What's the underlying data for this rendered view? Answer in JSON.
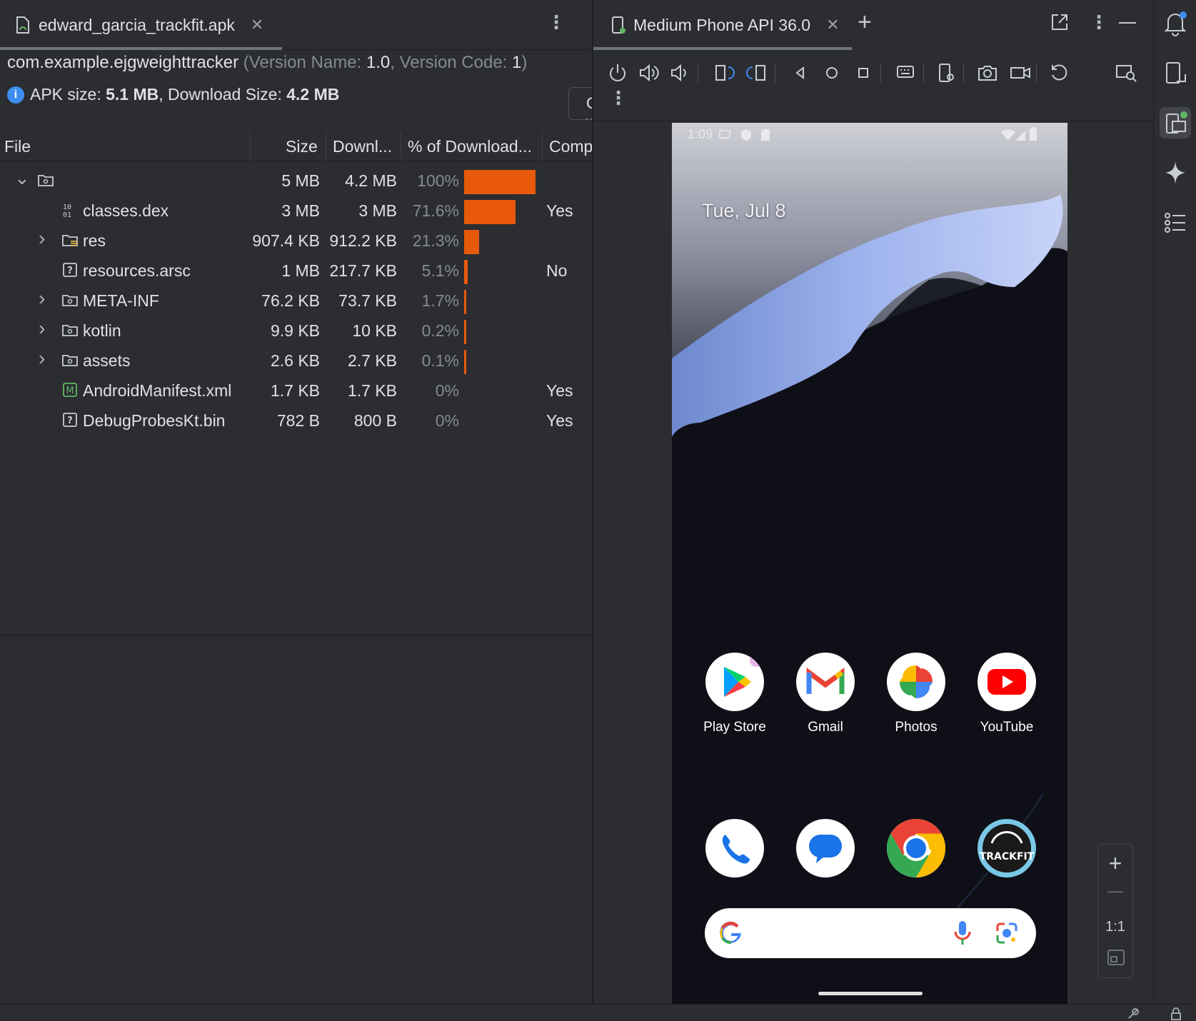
{
  "left_panel": {
    "tab": {
      "title": "edward_garcia_trackfit.apk"
    },
    "package": {
      "name": "com.example.ejgweighttracker",
      "open_paren": " (Version Name: ",
      "version_name": "1.0",
      "mid": ", Version Code: ",
      "version_code": "1",
      "close_paren": ")"
    },
    "sizes": {
      "apk_label": "APK size: ",
      "apk_value": "5.1 MB",
      "download_label": ", Download Size: ",
      "download_value": "4.2 MB"
    },
    "compare_label": "Compare with previous APK",
    "columns": {
      "file": "File",
      "size": "Size",
      "download": "Downl...",
      "percent": "% of Download...",
      "compressed": "Comp"
    },
    "rows": [
      {
        "name": "",
        "size": "5 MB",
        "download": "4.2 MB",
        "percent": "100%",
        "pct_value": 100,
        "compressed": "",
        "icon": "folder-icon",
        "expander": "expanded"
      },
      {
        "name": "classes.dex",
        "size": "3 MB",
        "download": "3 MB",
        "percent": "71.6%",
        "pct_value": 71.6,
        "compressed": "Yes",
        "icon": "dex-icon",
        "expander": "none"
      },
      {
        "name": "res",
        "size": "907.4 KB",
        "download": "912.2 KB",
        "percent": "21.3%",
        "pct_value": 21.3,
        "compressed": "",
        "icon": "resource-folder-icon",
        "expander": "collapsed"
      },
      {
        "name": "resources.arsc",
        "size": "1 MB",
        "download": "217.7 KB",
        "percent": "5.1%",
        "pct_value": 5.1,
        "compressed": "No",
        "icon": "unknown-file-icon",
        "expander": "none"
      },
      {
        "name": "META-INF",
        "size": "76.2 KB",
        "download": "73.7 KB",
        "percent": "1.7%",
        "pct_value": 1.7,
        "compressed": "",
        "icon": "folder-icon",
        "expander": "collapsed"
      },
      {
        "name": "kotlin",
        "size": "9.9 KB",
        "download": "10 KB",
        "percent": "0.2%",
        "pct_value": 0.2,
        "compressed": "",
        "icon": "folder-icon",
        "expander": "collapsed"
      },
      {
        "name": "assets",
        "size": "2.6 KB",
        "download": "2.7 KB",
        "percent": "0.1%",
        "pct_value": 0.1,
        "compressed": "",
        "icon": "folder-icon",
        "expander": "collapsed"
      },
      {
        "name": "AndroidManifest.xml",
        "size": "1.7 KB",
        "download": "1.7 KB",
        "percent": "0%",
        "pct_value": 0,
        "compressed": "Yes",
        "icon": "manifest-icon",
        "expander": "none"
      },
      {
        "name": "DebugProbesKt.bin",
        "size": "782 B",
        "download": "800 B",
        "percent": "0%",
        "pct_value": 0,
        "compressed": "Yes",
        "icon": "unknown-file-icon",
        "expander": "none"
      }
    ],
    "bar_color": "#e8590c"
  },
  "right_panel": {
    "tab": {
      "title": "Medium Phone API 36.0"
    },
    "device": {
      "time": "1:09",
      "date": "Tue, Jul 8",
      "apps_row1": [
        {
          "label": "Play Store",
          "icon": "play-store-icon"
        },
        {
          "label": "Gmail",
          "icon": "gmail-icon"
        },
        {
          "label": "Photos",
          "icon": "photos-icon"
        },
        {
          "label": "YouTube",
          "icon": "youtube-icon"
        }
      ],
      "dock": [
        {
          "icon": "phone-icon"
        },
        {
          "icon": "messages-icon"
        },
        {
          "icon": "chrome-icon"
        },
        {
          "icon": "trackfit-icon",
          "text": "TRACKFIT"
        }
      ]
    },
    "zoom": {
      "in": "+",
      "out": "—",
      "actual": "1:1"
    }
  },
  "colors": {
    "accent_blue": "#3d8ef0",
    "ide_bg": "#2b2d30",
    "bar_orange": "#e8590c"
  }
}
